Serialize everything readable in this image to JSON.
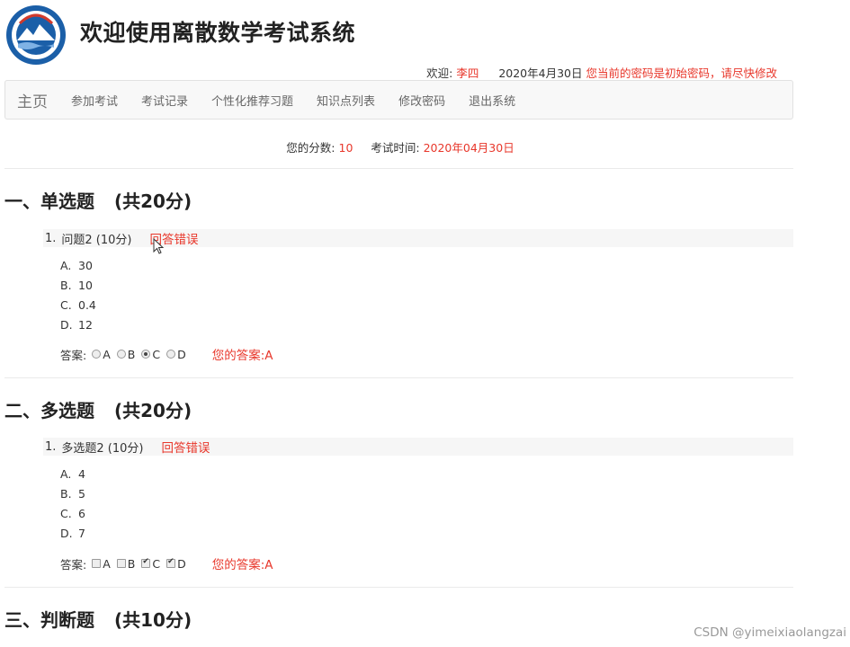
{
  "header": {
    "title": "欢迎使用离散数学考试系统",
    "logo_icon": "university-logo-icon"
  },
  "userbar": {
    "welcome_label": "欢迎:",
    "user_name": "李四",
    "date": "2020年4月30日",
    "warning": "您当前的密码是初始密码，请尽快修改"
  },
  "nav": {
    "brand": "主页",
    "items": [
      "参加考试",
      "考试记录",
      "个性化推荐习题",
      "知识点列表",
      "修改密码",
      "退出系统"
    ]
  },
  "score": {
    "score_label": "您的分数:",
    "score_value": "10",
    "time_label": "考试时间:",
    "time_value": "2020年04月30日"
  },
  "sections": [
    {
      "title": "一、单选题",
      "points": "(共20分)",
      "question": {
        "number": "1.",
        "text": "问题2 (10分)",
        "result": "回答错误",
        "options": [
          {
            "letter": "A.",
            "text": "30"
          },
          {
            "letter": "B.",
            "text": "10"
          },
          {
            "letter": "C.",
            "text": "0.4"
          },
          {
            "letter": "D.",
            "text": "12"
          }
        ],
        "answer_label": "答案:",
        "choices": [
          "A",
          "B",
          "C",
          "D"
        ],
        "selected": [
          "C"
        ],
        "your_answer": "您的答案:A"
      }
    },
    {
      "title": "二、多选题",
      "points": "(共20分)",
      "question": {
        "number": "1.",
        "text": "多选题2 (10分)",
        "result": "回答错误",
        "options": [
          {
            "letter": "A.",
            "text": "4"
          },
          {
            "letter": "B.",
            "text": "5"
          },
          {
            "letter": "C.",
            "text": "6"
          },
          {
            "letter": "D.",
            "text": "7"
          }
        ],
        "answer_label": "答案:",
        "choices": [
          "A",
          "B",
          "C",
          "D"
        ],
        "selected": [
          "C",
          "D"
        ],
        "your_answer": "您的答案:A"
      }
    },
    {
      "title": "三、判断题",
      "points": "(共10分)"
    }
  ],
  "watermark": "CSDN @yimeixiaolangzai",
  "colors": {
    "accent_red": "#e8372b",
    "nav_bg": "#f8f8f8"
  }
}
